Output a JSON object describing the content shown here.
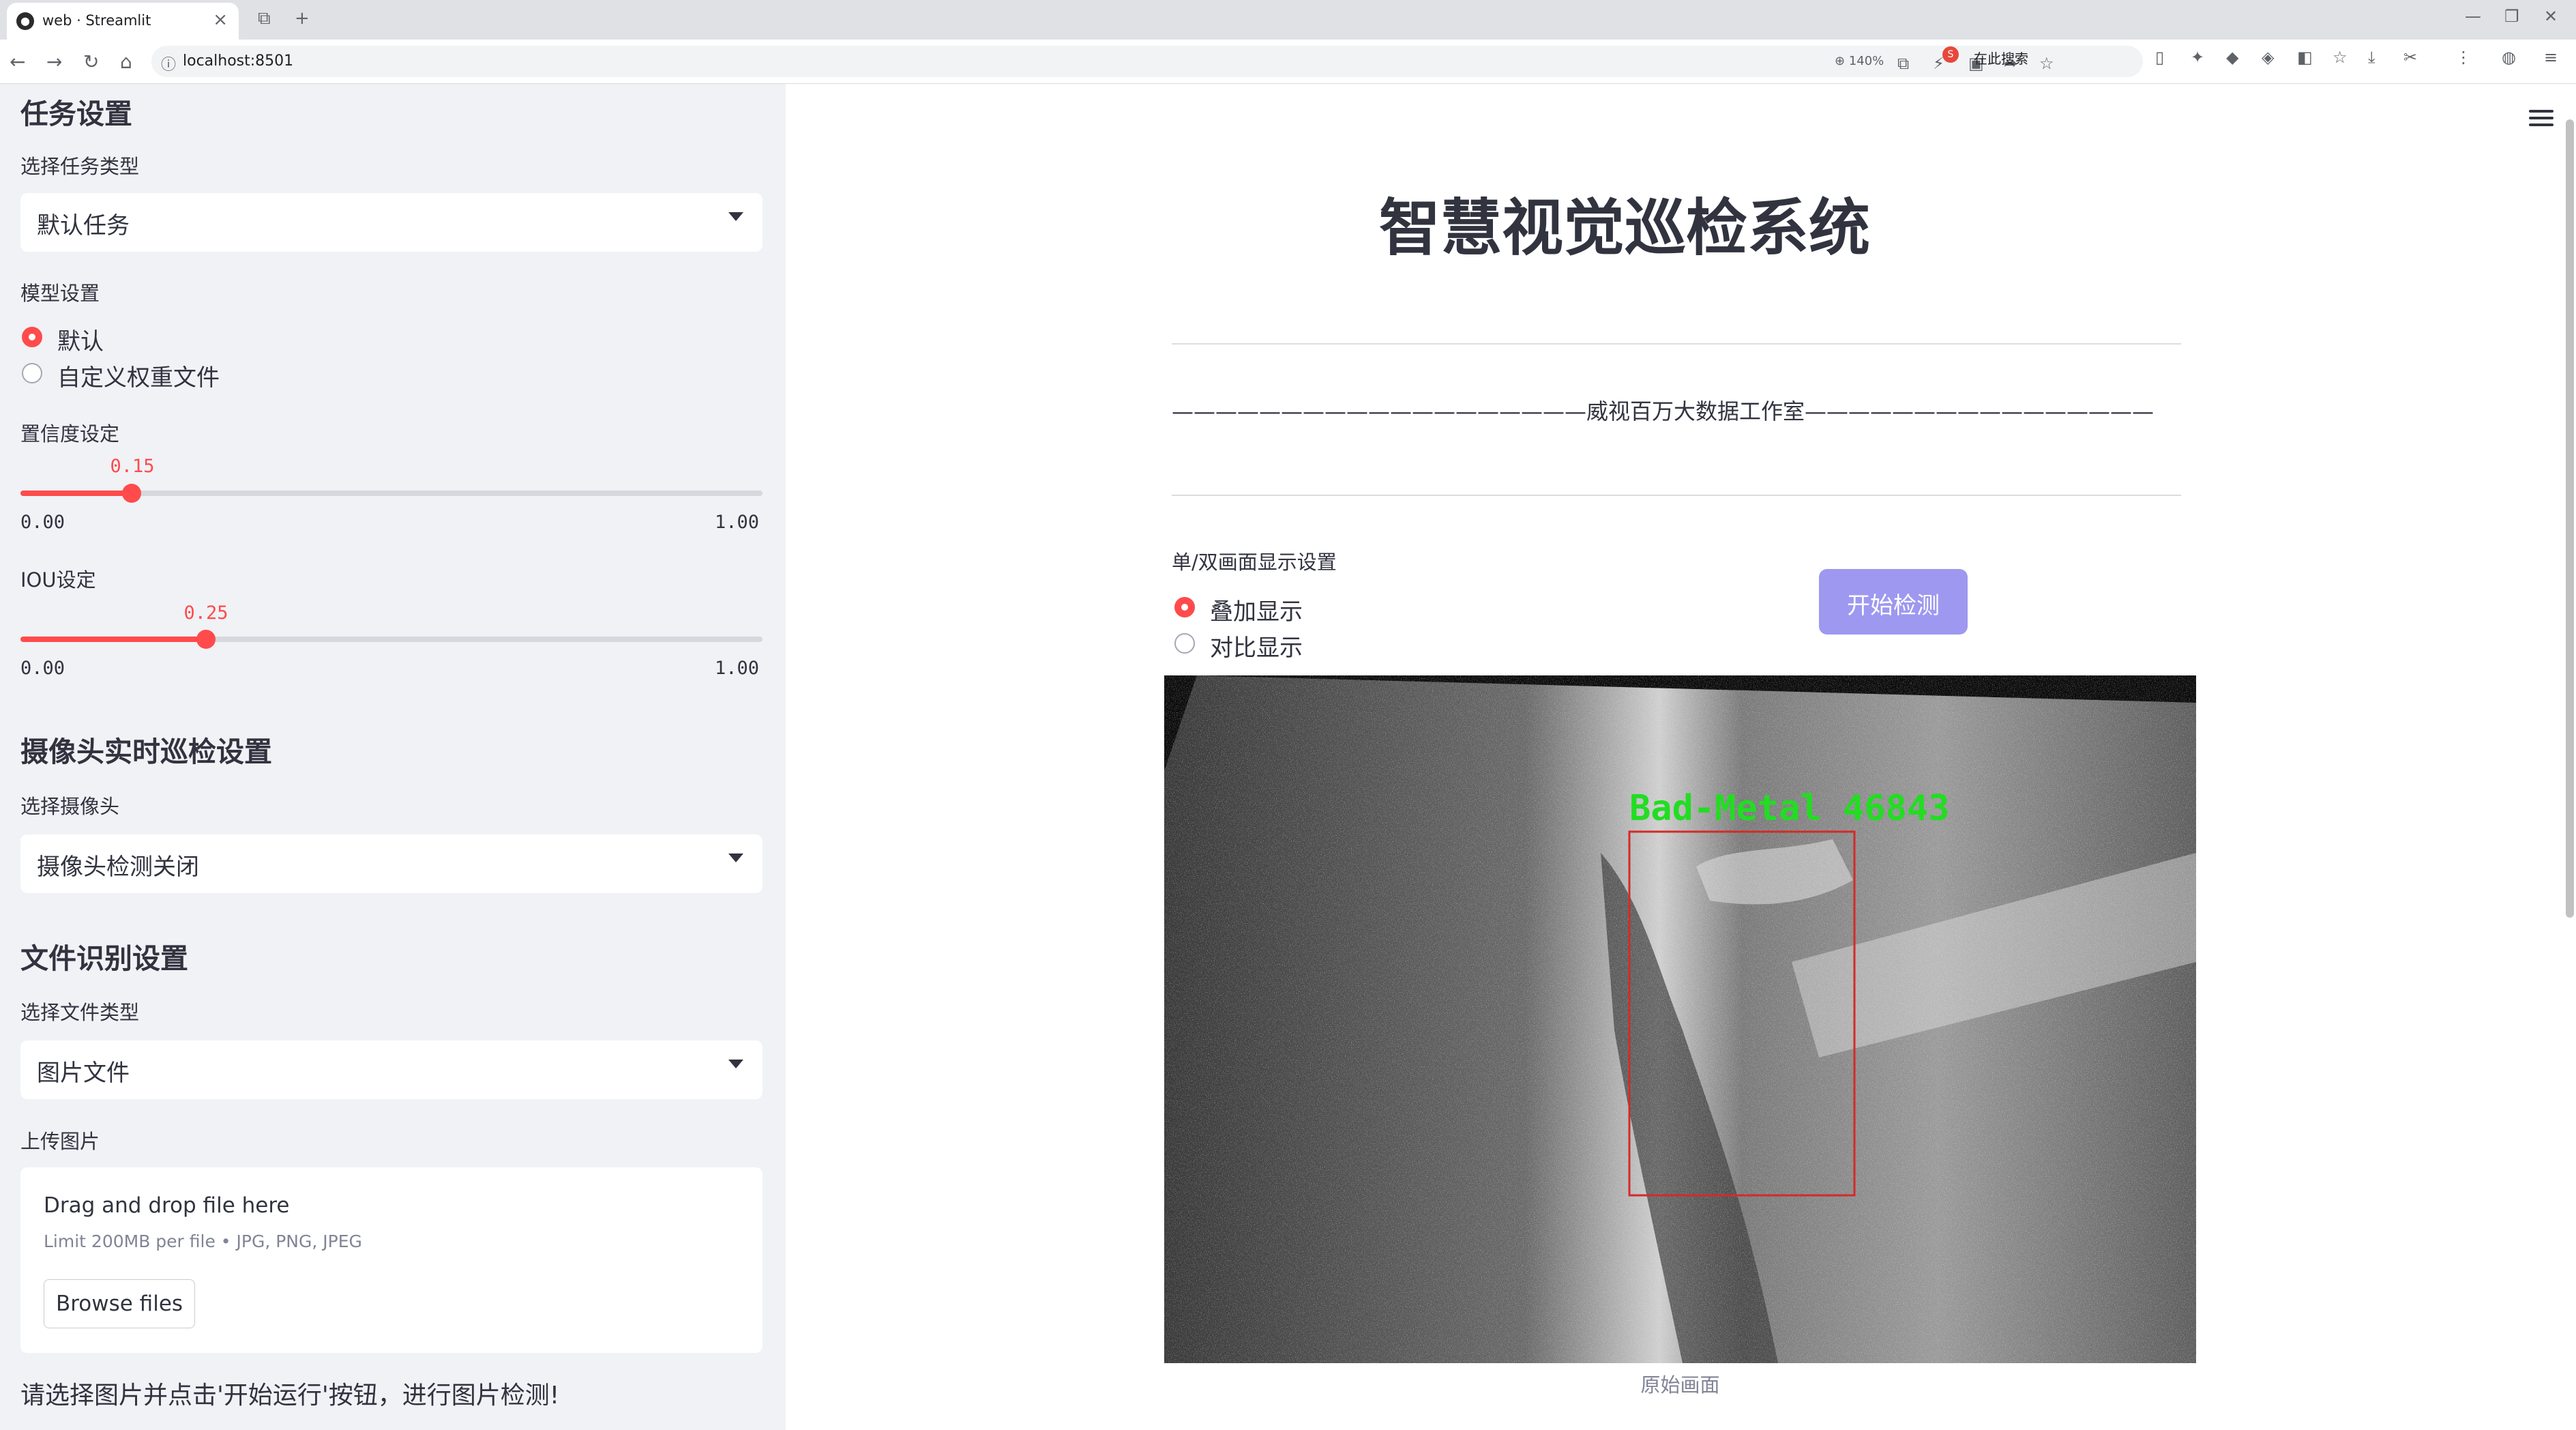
{
  "browser": {
    "tab_title": "web · Streamlit",
    "url": "localhost:8501",
    "zoom": "140%",
    "search_placeholder": "在此搜索"
  },
  "sidebar": {
    "task_header": "任务设置",
    "task_type_label": "选择任务类型",
    "task_type_value": "默认任务",
    "model_label": "模型设置",
    "model_options": [
      "默认",
      "自定义权重文件"
    ],
    "model_selected": "默认",
    "conf_label": "置信度设定",
    "conf": {
      "value": 0.15,
      "value_text": "0.15",
      "min": "0.00",
      "max": "1.00"
    },
    "iou_label": "IOU设定",
    "iou": {
      "value": 0.25,
      "value_text": "0.25",
      "min": "0.00",
      "max": "1.00"
    },
    "camera_header": "摄像头实时巡检设置",
    "camera_label": "选择摄像头",
    "camera_value": "摄像头检测关闭",
    "file_header": "文件识别设置",
    "file_type_label": "选择文件类型",
    "file_type_value": "图片文件",
    "upload_label": "上传图片",
    "upload_title": "Drag and drop file here",
    "upload_limit": "Limit 200MB per file • JPG, PNG, JPEG",
    "browse_label": "Browse files",
    "info_text": "请选择图片并点击'开始运行'按钮，进行图片检测!"
  },
  "main": {
    "title": "智慧视觉巡检系统",
    "subtitle": "———————————————————威视百万大数据工作室————————————————————",
    "display_label": "单/双画面显示设置",
    "display_options": [
      "叠加显示",
      "对比显示"
    ],
    "display_selected": "叠加显示",
    "start_button": "开始检测",
    "detection_label": "Bad-Metal 46843",
    "image_caption": "原始画面"
  },
  "colors": {
    "accent": "#ff4b4b",
    "button": "#9e98f0",
    "sidebar_bg": "#f0f2f6",
    "detection_box": "#d42a2a",
    "detection_text": "#22dd22"
  }
}
